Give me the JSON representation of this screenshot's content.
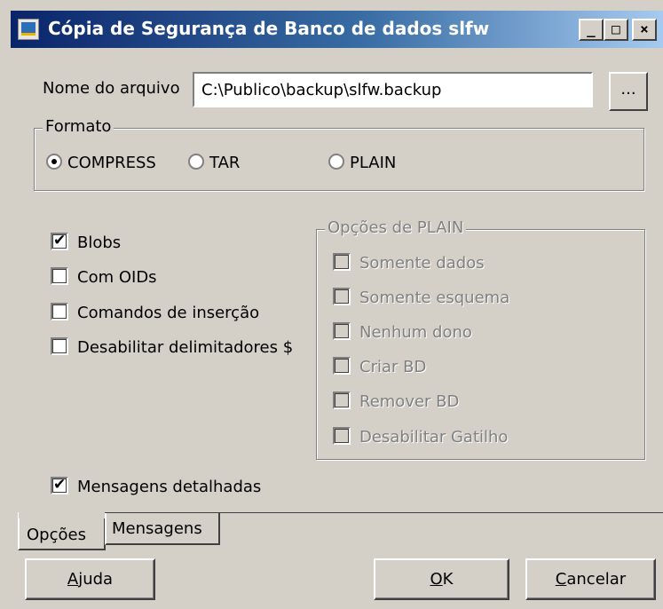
{
  "window": {
    "title": "Cópia de Segurança de Banco de dados slfw",
    "controls": {
      "minimize": "_",
      "maximize": "□",
      "close": "×"
    }
  },
  "file": {
    "label": "Nome do arquivo",
    "value": "C:\\Publico\\backup\\slfw.backup",
    "browse_label": "..."
  },
  "format": {
    "legend": "Formato",
    "options": [
      {
        "label": "COMPRESS",
        "checked": true
      },
      {
        "label": "TAR",
        "checked": false
      },
      {
        "label": "PLAIN",
        "checked": false
      }
    ]
  },
  "options": [
    {
      "label": "Blobs",
      "checked": true
    },
    {
      "label": "Com OIDs",
      "checked": false
    },
    {
      "label": "Comandos de inserção",
      "checked": false
    },
    {
      "label": "Desabilitar delimitadores $",
      "checked": false
    }
  ],
  "plain_options": {
    "legend": "Opções de PLAIN",
    "enabled": false,
    "items": [
      {
        "label": "Somente dados",
        "checked": false
      },
      {
        "label": "Somente esquema",
        "checked": false
      },
      {
        "label": "Nenhum dono",
        "checked": false
      },
      {
        "label": "Criar BD",
        "checked": false
      },
      {
        "label": "Remover BD",
        "checked": false
      },
      {
        "label": "Desabilitar Gatilho",
        "checked": false
      }
    ]
  },
  "verbose": {
    "label": "Mensagens detalhadas",
    "checked": true
  },
  "tabs": [
    {
      "label": "Opções",
      "active": true
    },
    {
      "label": "Mensagens",
      "active": false
    }
  ],
  "buttons": {
    "help": "Ajuda",
    "ok": "OK",
    "cancel": "Cancelar"
  },
  "colors": {
    "title_start": "#0a246a",
    "title_end": "#a6caf0",
    "face": "#d4d0c8"
  }
}
